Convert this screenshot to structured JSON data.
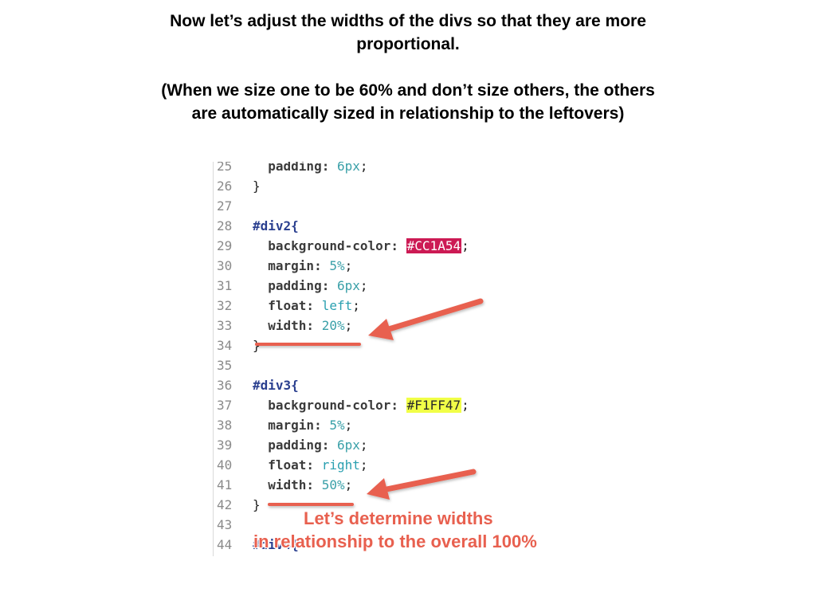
{
  "heading": {
    "line1": "Now let’s adjust the widths of the divs so that they are more",
    "line2": "proportional.",
    "line3": "(When we size one to be 60% and don’t size others, the others",
    "line4": "are automatically sized in relationship to the leftovers)"
  },
  "code": {
    "lines": [
      {
        "n": "25",
        "indent": "  ",
        "prop": "padding: ",
        "val": "6px",
        "end": ";"
      },
      {
        "n": "26",
        "text": "}"
      },
      {
        "n": "27",
        "text": ""
      },
      {
        "n": "28",
        "sel": "#div2{"
      },
      {
        "n": "29",
        "indent": "  ",
        "prop": "background-color: ",
        "color": "#CC1A54",
        "end": ";"
      },
      {
        "n": "30",
        "indent": "  ",
        "prop": "margin: ",
        "val": "5%",
        "end": ";"
      },
      {
        "n": "31",
        "indent": "  ",
        "prop": "padding: ",
        "val": "6px",
        "end": ";"
      },
      {
        "n": "32",
        "indent": "  ",
        "prop": "float: ",
        "kw": "left",
        "end": ";"
      },
      {
        "n": "33",
        "indent": "  ",
        "prop": "width: ",
        "val": "20%",
        "end": ";"
      },
      {
        "n": "34",
        "text": "}"
      },
      {
        "n": "35",
        "text": ""
      },
      {
        "n": "36",
        "sel": "#div3{"
      },
      {
        "n": "37",
        "indent": "  ",
        "prop": "background-color: ",
        "color": "#F1FF47",
        "end": ";"
      },
      {
        "n": "38",
        "indent": "  ",
        "prop": "margin: ",
        "val": "5%",
        "end": ";"
      },
      {
        "n": "39",
        "indent": "  ",
        "prop": "padding: ",
        "val": "6px",
        "end": ";"
      },
      {
        "n": "40",
        "indent": "  ",
        "prop": "float: ",
        "kw": "right",
        "end": ";"
      },
      {
        "n": "41",
        "indent": "  ",
        "prop": "width: ",
        "val": "50%",
        "end": ";"
      },
      {
        "n": "42",
        "text": "}"
      },
      {
        "n": "43",
        "text": ""
      },
      {
        "n": "44",
        "sel": "#div4{"
      }
    ]
  },
  "callout": {
    "line1": "Let’s determine widths",
    "line2": "in relationship to the overall 100%",
    "color": "#E8604F"
  }
}
